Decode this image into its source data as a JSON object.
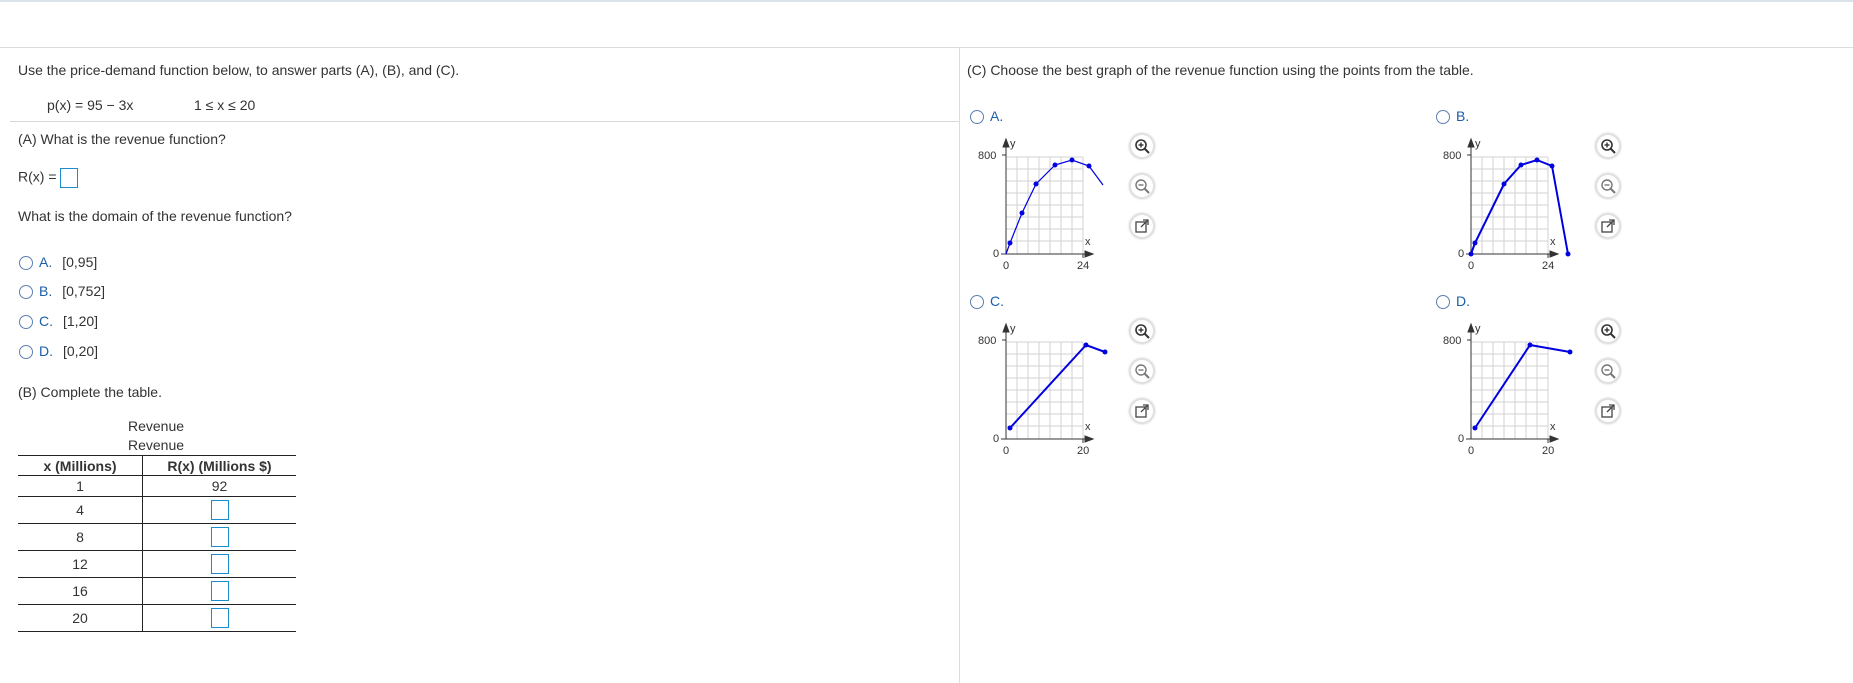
{
  "left": {
    "intro": "Use the price-demand function below, to answer parts (A), (B), and (C).",
    "function": "p(x) = 95 − 3x",
    "domain_constraint": "1 ≤ x ≤ 20",
    "part_a_question": "(A) What is the revenue function?",
    "revenue_label": "R(x) =",
    "domain_question": "What is the domain of the revenue function?",
    "options": [
      {
        "letter": "A.",
        "text": "[0,95]"
      },
      {
        "letter": "B.",
        "text": "[0,752]"
      },
      {
        "letter": "C.",
        "text": "[1,20]"
      },
      {
        "letter": "D.",
        "text": "[0,20]"
      }
    ],
    "part_b_prompt": "(B) Complete the table.",
    "table": {
      "caption_1": "Revenue",
      "caption_2": "Revenue",
      "headers": [
        "x (Millions)",
        "R(x) (Millions $)"
      ],
      "rows": [
        {
          "x": "1",
          "r": "92"
        },
        {
          "x": "4",
          "r": ""
        },
        {
          "x": "8",
          "r": ""
        },
        {
          "x": "12",
          "r": ""
        },
        {
          "x": "16",
          "r": ""
        },
        {
          "x": "20",
          "r": ""
        }
      ]
    }
  },
  "right": {
    "prompt": "(C) Choose the best graph of the revenue function using the points from the table.",
    "graph_options": [
      {
        "label": "A.",
        "y_top": "800",
        "y_zero": "0",
        "x_zero": "0",
        "x_max": "24",
        "y_axis": "y",
        "x_axis": "x"
      },
      {
        "label": "B.",
        "y_top": "800",
        "y_zero": "0",
        "x_zero": "0",
        "x_max": "24",
        "y_axis": "y",
        "x_axis": "x"
      },
      {
        "label": "C.",
        "y_top": "800",
        "y_zero": "0",
        "x_zero": "0",
        "x_max": "20",
        "y_axis": "y",
        "x_axis": "x"
      },
      {
        "label": "D.",
        "y_top": "800",
        "y_zero": "0",
        "x_zero": "0",
        "x_max": "20",
        "y_axis": "y",
        "x_axis": "x"
      }
    ],
    "tool_icons": [
      "zoom-in-icon",
      "zoom-out-icon",
      "popout-icon"
    ],
    "accent_color": "#1a5fa8",
    "line_color": "#0000e0"
  }
}
